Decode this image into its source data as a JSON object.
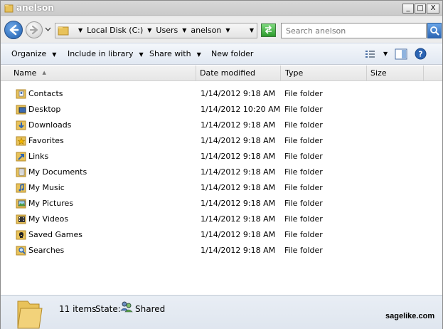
{
  "window": {
    "title": "anelson",
    "minimize_glyph": "_",
    "maximize_glyph": "□",
    "close_glyph": "X"
  },
  "address": {
    "breadcrumbs": [
      "Local Disk (C:)",
      "Users",
      "anelson"
    ],
    "search_placeholder": "Search anelson"
  },
  "toolbar": {
    "organize": "Organize",
    "include_in_library": "Include in library",
    "share_with": "Share with",
    "new_folder": "New folder"
  },
  "columns": [
    "Name",
    "Date modified",
    "Type",
    "Size"
  ],
  "files": [
    {
      "name": "Contacts",
      "date": "1/14/2012 9:18 AM",
      "type": "File folder",
      "icon": "contacts-folder-icon"
    },
    {
      "name": "Desktop",
      "date": "1/14/2012 10:20 AM",
      "type": "File folder",
      "icon": "desktop-folder-icon"
    },
    {
      "name": "Downloads",
      "date": "1/14/2012 9:18 AM",
      "type": "File folder",
      "icon": "downloads-folder-icon"
    },
    {
      "name": "Favorites",
      "date": "1/14/2012 9:18 AM",
      "type": "File folder",
      "icon": "favorites-folder-icon"
    },
    {
      "name": "Links",
      "date": "1/14/2012 9:18 AM",
      "type": "File folder",
      "icon": "links-folder-icon"
    },
    {
      "name": "My Documents",
      "date": "1/14/2012 9:18 AM",
      "type": "File folder",
      "icon": "documents-folder-icon"
    },
    {
      "name": "My Music",
      "date": "1/14/2012 9:18 AM",
      "type": "File folder",
      "icon": "music-folder-icon"
    },
    {
      "name": "My Pictures",
      "date": "1/14/2012 9:18 AM",
      "type": "File folder",
      "icon": "pictures-folder-icon"
    },
    {
      "name": "My Videos",
      "date": "1/14/2012 9:18 AM",
      "type": "File folder",
      "icon": "videos-folder-icon"
    },
    {
      "name": "Saved Games",
      "date": "1/14/2012 9:18 AM",
      "type": "File folder",
      "icon": "saved-games-folder-icon"
    },
    {
      "name": "Searches",
      "date": "1/14/2012 9:18 AM",
      "type": "File folder",
      "icon": "searches-folder-icon"
    }
  ],
  "details": {
    "item_count": "11 items",
    "state_label": "State:",
    "state_value": "Shared"
  },
  "watermark": "sagelike.com",
  "colors": {
    "folder": "#e8c25a",
    "accent": "#2b64b3"
  }
}
